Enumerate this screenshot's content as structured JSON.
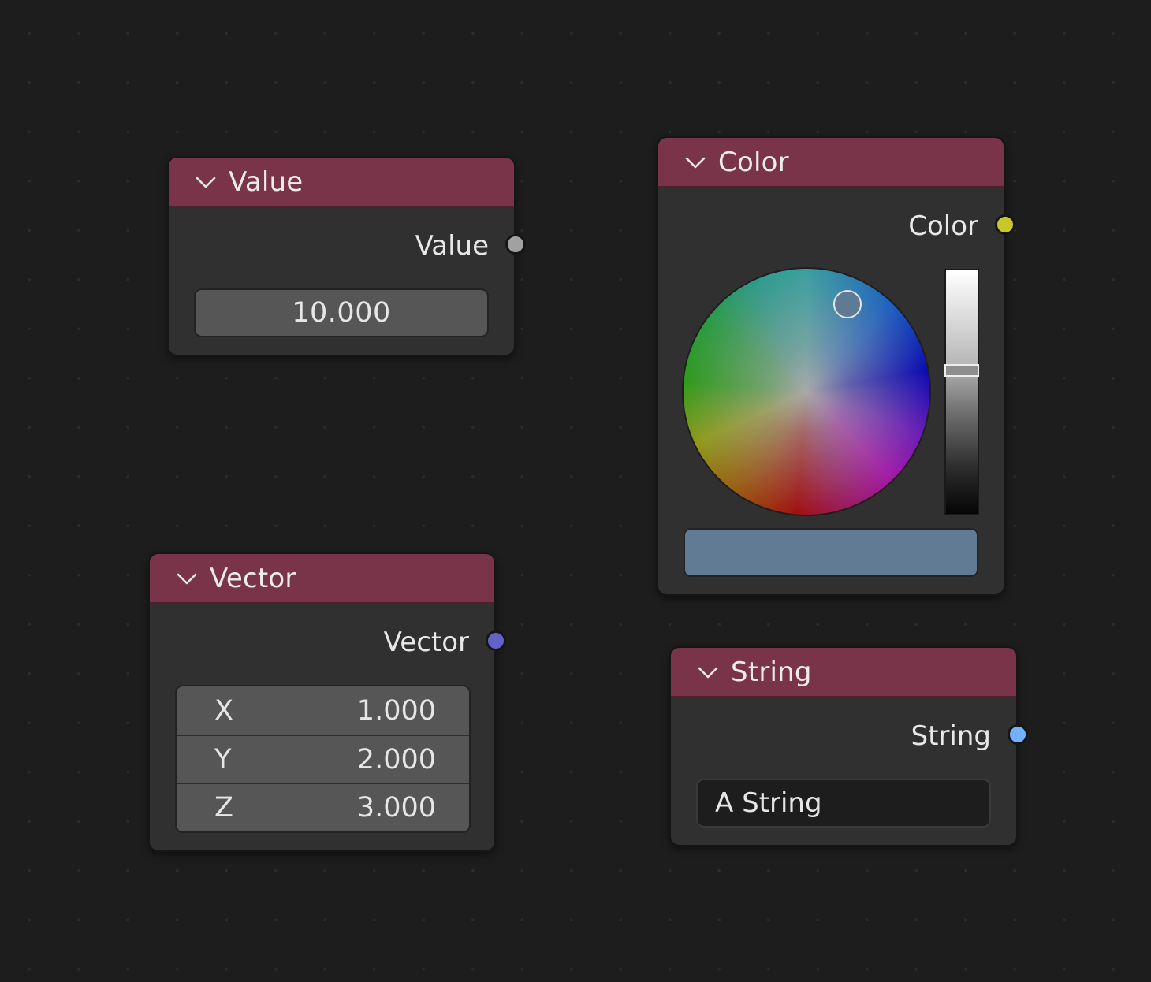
{
  "nodes": {
    "value": {
      "title": "Value",
      "output_label": "Value",
      "field_value": "10.000",
      "socket_color": "#a1a1a1"
    },
    "color": {
      "title": "Color",
      "output_label": "Color",
      "socket_color": "#c7c729",
      "swatch_color": "#617b95"
    },
    "vector": {
      "title": "Vector",
      "output_label": "Vector",
      "socket_color": "#6363c7",
      "fields": [
        {
          "label": "X",
          "value": "1.000"
        },
        {
          "label": "Y",
          "value": "2.000"
        },
        {
          "label": "Z",
          "value": "3.000"
        }
      ]
    },
    "string": {
      "title": "String",
      "output_label": "String",
      "field_value": "A String",
      "socket_color": "#70b2ff"
    }
  },
  "theme": {
    "header_color": "#7a344a",
    "node_body": "#303030",
    "canvas": "#1d1d1d"
  },
  "icons": [
    "chevron-down-icon"
  ]
}
